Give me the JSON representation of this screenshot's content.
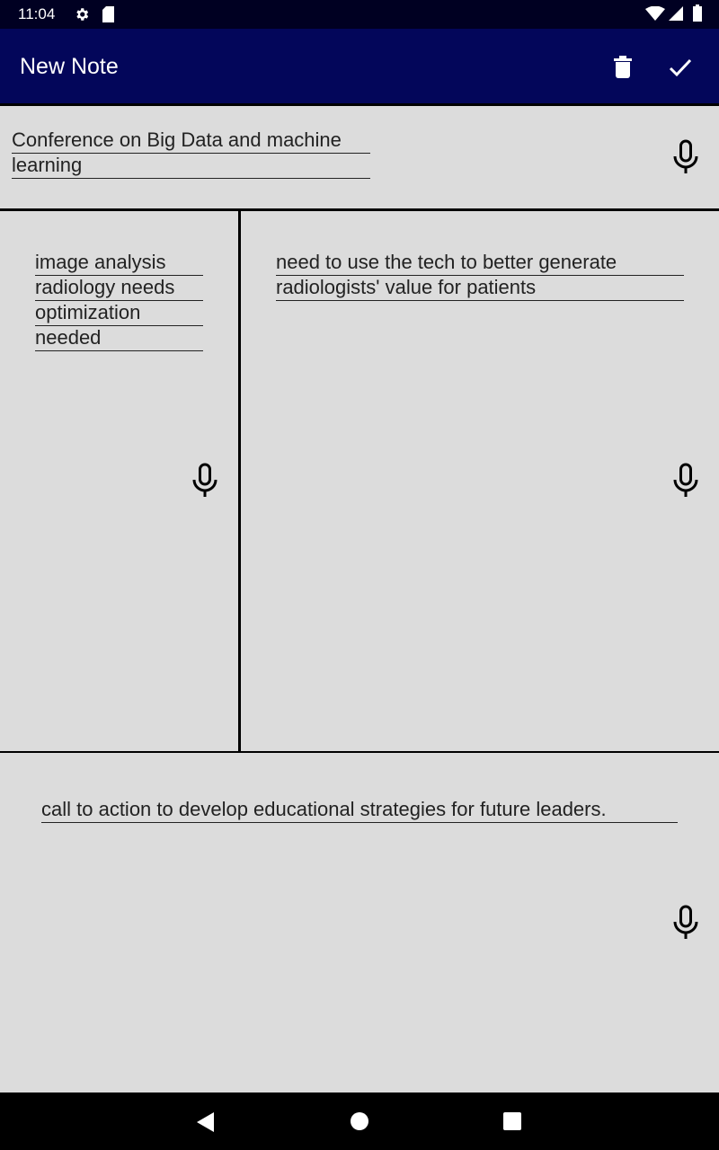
{
  "status_bar": {
    "time": "11:04",
    "icons": [
      "gear-icon",
      "sd-card-icon",
      "wifi-icon",
      "signal-icon",
      "battery-icon"
    ]
  },
  "app_bar": {
    "title": "New Note",
    "actions": [
      "delete-icon",
      "check-icon"
    ],
    "color": "#03065a"
  },
  "note": {
    "title_lines": [
      "Conference on Big Data and machine",
      "learning"
    ],
    "left_lines": [
      "image analysis",
      "radiology needs",
      "optimization",
      "needed"
    ],
    "right_lines": [
      "need to use the tech to better generate",
      "radiologists' value for patients"
    ],
    "bottom_lines": [
      "call to action to develop educational strategies for future leaders."
    ]
  },
  "nav_bar": {
    "buttons": [
      "back-icon",
      "home-icon",
      "recents-icon"
    ]
  }
}
